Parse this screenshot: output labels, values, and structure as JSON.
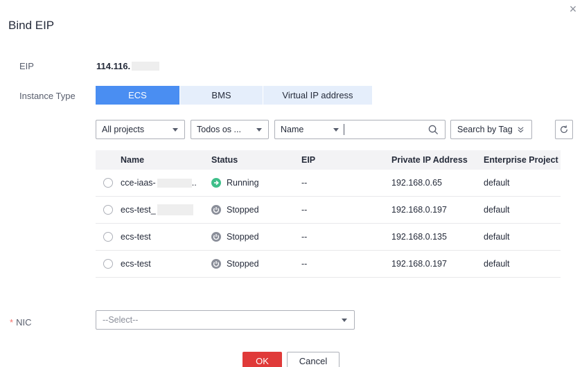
{
  "dialog": {
    "title": "Bind EIP",
    "close_glyph": "×"
  },
  "eip": {
    "label": "EIP",
    "value_visible": "114.116."
  },
  "instance_type": {
    "label": "Instance Type",
    "options": [
      "ECS",
      "BMS",
      "Virtual IP address"
    ],
    "selected": "ECS"
  },
  "filters": {
    "project": "All projects",
    "todos": "Todos os ...",
    "search_field": "Name",
    "search_value": "",
    "tag_button": "Search by Tag"
  },
  "table": {
    "columns": [
      "Name",
      "Status",
      "EIP",
      "Private IP Address",
      "Enterprise Project"
    ],
    "rows": [
      {
        "name": "cce-iaas-",
        "name_suffix": "..",
        "status": "Running",
        "eip": "--",
        "ip": "192.168.0.65",
        "project": "default"
      },
      {
        "name": "ecs-test_",
        "name_suffix": "",
        "status": "Stopped",
        "eip": "--",
        "ip": "192.168.0.197",
        "project": "default"
      },
      {
        "name": "ecs-test",
        "name_suffix": "",
        "status": "Stopped",
        "eip": "--",
        "ip": "192.168.0.135",
        "project": "default"
      },
      {
        "name": "ecs-test",
        "name_suffix": "",
        "status": "Stopped",
        "eip": "--",
        "ip": "192.168.0.197",
        "project": "default"
      }
    ]
  },
  "nic": {
    "required_mark": "*",
    "label": "NIC",
    "placeholder": "--Select--"
  },
  "footer": {
    "ok_label": "OK",
    "cancel_label": "Cancel"
  },
  "colors": {
    "accent": "#4a8ef2",
    "running": "#3fbf8a",
    "stopped": "#8a8e99",
    "ok": "#e03a39"
  },
  "icons": {
    "close": "close-icon",
    "search": "search-icon",
    "chevron": "double-chevron-down-icon",
    "refresh": "refresh-icon",
    "running": "running-status-icon",
    "stopped": "power-stopped-icon"
  }
}
